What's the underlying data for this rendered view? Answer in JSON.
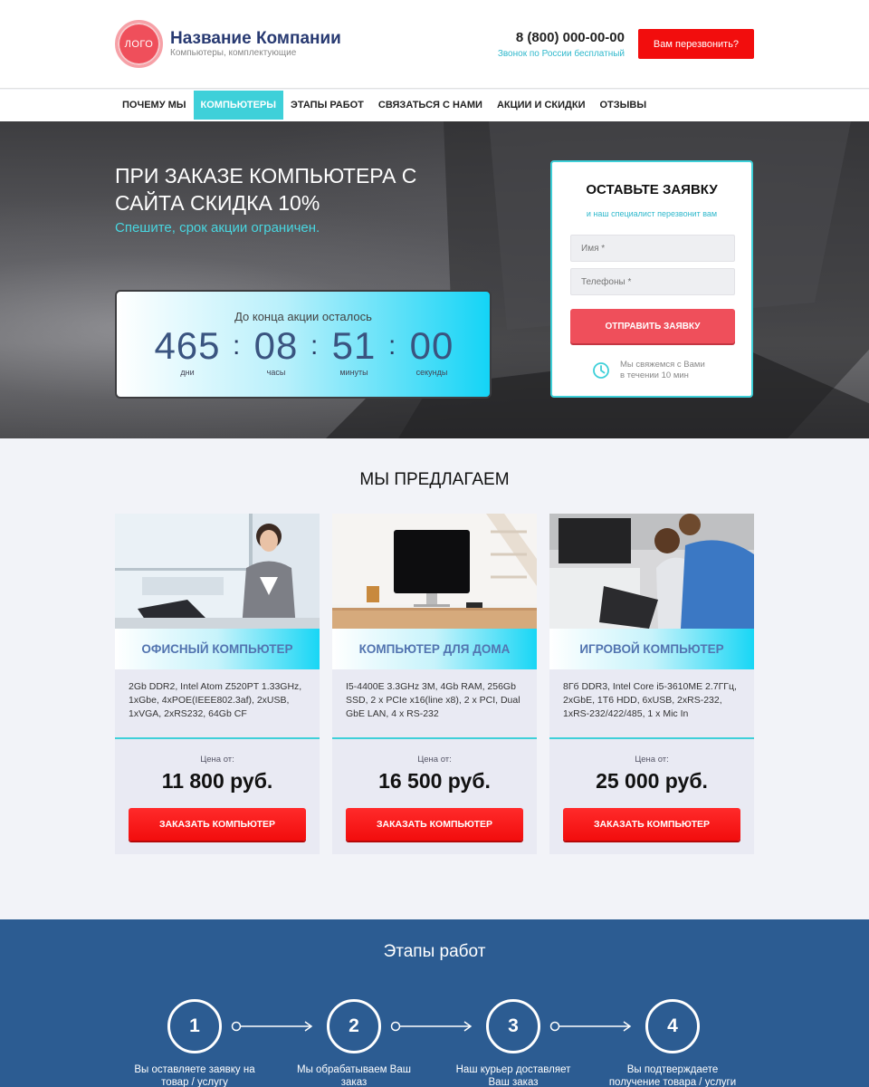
{
  "header": {
    "logo": "ЛОГО",
    "company_name": "Название Компании",
    "company_sub": "Компьютеры, комплектующие",
    "phone": "8 (800) 000-00-00",
    "phone_note": "Звонок по России бесплатный",
    "callback_label": "Вам перезвонить?"
  },
  "nav": {
    "items": [
      {
        "label": "ПОЧЕМУ МЫ"
      },
      {
        "label": "КОМПЬЮТЕРЫ"
      },
      {
        "label": "ЭТАПЫ РАБОТ"
      },
      {
        "label": "СВЯЗАТЬСЯ С НАМИ"
      },
      {
        "label": "АКЦИИ И СКИДКИ"
      },
      {
        "label": "ОТЗЫВЫ"
      }
    ],
    "active": "КОМПЬЮТЕРЫ"
  },
  "hero": {
    "title": "ПРИ ЗАКАЗЕ КОМПЬЮТЕРА С САЙТА СКИДКА 10%",
    "subtitle": "Спешите, срок акции ограничен.",
    "countdown": {
      "title": "До конца акции осталось",
      "days": "465",
      "days_label": "дни",
      "hours": "08",
      "hours_label": "часы",
      "minutes": "51",
      "minutes_label": "минуты",
      "seconds": "00",
      "seconds_label": "секунды",
      "separator": ":"
    }
  },
  "form": {
    "title": "ОСТАВЬТЕ ЗАЯВКУ",
    "subtitle": "и наш специалист перезвонит вам",
    "name_placeholder": "Имя *",
    "phone_placeholder": "Телефоны *",
    "submit_label": "ОТПРАВИТЬ ЗАЯВКУ",
    "note_line1": "Мы свяжемся с Вами",
    "note_line2": "в течении 10 мин"
  },
  "offers": {
    "title": "МЫ ПРЕДЛАГАЕМ",
    "items": [
      {
        "name": "ОФИСНЫЙ КОМПЬЮТЕР",
        "specs": "2Gb DDR2, Intel Atom Z520PT 1.33GHz, 1xGbe, 4xPOE(IEEE802.3af), 2xUSB, 1xVGA, 2xRS232, 64Gb CF",
        "price_label": "Цена от:",
        "price": "11 800 руб.",
        "button": "ЗАКАЗАТЬ КОМПЬЮТЕР"
      },
      {
        "name": "КОМПЬЮТЕР ДЛЯ ДОМА",
        "specs": "I5-4400E 3.3GHz 3M, 4Gb RAM, 256Gb SSD, 2 x PCIe x16(line x8), 2 x PCI, Dual GbE LAN, 4 x RS-232",
        "price_label": "Цена от:",
        "price": "16 500 руб.",
        "button": "ЗАКАЗАТЬ КОМПЬЮТЕР"
      },
      {
        "name": "ИГРОВОЙ КОМПЬЮТЕР",
        "specs": "8Гб DDR3, Intel Core i5-3610ME 2.7ГГц, 2xGbE, 1Т6 HDD, 6xUSB, 2xRS-232, 1xRS-232/422/485, 1 x Mic In",
        "price_label": "Цена от:",
        "price": "25 000 руб.",
        "button": "ЗАКАЗАТЬ КОМПЬЮТЕР"
      }
    ]
  },
  "steps": {
    "title": "Этапы работ",
    "items": [
      {
        "num": "1",
        "text": "Вы оставляете заявку на товар / услугу"
      },
      {
        "num": "2",
        "text": "Мы обрабатываем Ваш заказ"
      },
      {
        "num": "3",
        "text": "Наш курьер доставляет Ваш заказ"
      },
      {
        "num": "4",
        "text": "Вы подтверждаете получение товара / услуги"
      }
    ]
  },
  "colors": {
    "accent_cyan": "#3ed0d9",
    "brand_red": "#f20d0d",
    "logo_red": "#ef4f5b",
    "steps_blue": "#2c5c92",
    "title_navy": "#283a72"
  }
}
